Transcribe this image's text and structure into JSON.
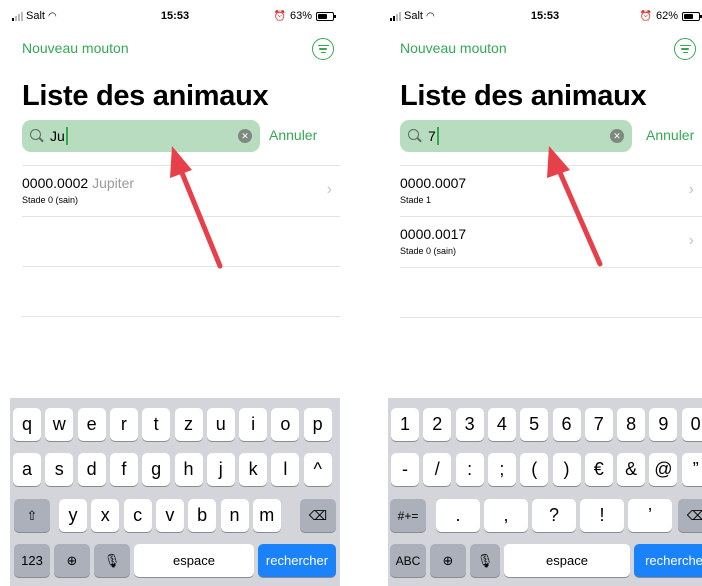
{
  "screens": [
    {
      "status": {
        "carrier": "Salt",
        "time": "15:53",
        "battery": "63%",
        "battery_level": 0.63
      },
      "nav": {
        "new_label": "Nouveau mouton"
      },
      "title": "Liste des animaux",
      "search": {
        "value": "Ju",
        "cancel": "Annuler"
      },
      "rows": [
        {
          "id": "0000.0002",
          "name": "Jupiter",
          "stage": "Stade 0 (sain)"
        }
      ],
      "keyboard": {
        "row1": [
          "q",
          "w",
          "e",
          "r",
          "t",
          "z",
          "u",
          "i",
          "o",
          "p"
        ],
        "row2": [
          "a",
          "s",
          "d",
          "f",
          "g",
          "h",
          "j",
          "k",
          "l",
          "^"
        ],
        "row3": [
          "y",
          "x",
          "c",
          "v",
          "b",
          "n",
          "m"
        ],
        "mode_key": "123",
        "space": "espace",
        "go": "rechercher"
      }
    },
    {
      "status": {
        "carrier": "Salt",
        "time": "15:53",
        "battery": "62%",
        "battery_level": 0.62
      },
      "nav": {
        "new_label": "Nouveau mouton"
      },
      "title": "Liste des animaux",
      "search": {
        "value": "7",
        "cancel": "Annuler"
      },
      "rows": [
        {
          "id": "0000.0007",
          "name": "",
          "stage": "Stade 1"
        },
        {
          "id": "0000.0017",
          "name": "",
          "stage": "Stade 0 (sain)"
        }
      ],
      "keyboard": {
        "row1": [
          "1",
          "2",
          "3",
          "4",
          "5",
          "6",
          "7",
          "8",
          "9",
          "0"
        ],
        "row2": [
          "-",
          "/",
          ":",
          ";",
          "(",
          ")",
          "€",
          "&",
          "@",
          "”"
        ],
        "row3": [
          ".",
          ",",
          "?",
          "!",
          "’"
        ],
        "shift_label": "#+=",
        "mode_key": "ABC",
        "space": "espace",
        "go": "recherche"
      }
    }
  ],
  "icons": {
    "search": "magnifier-icon",
    "clear": "clear-circle-icon",
    "filter": "filter-circle-icon",
    "globe": "globe-icon",
    "mic": "microphone-icon",
    "backspace": "backspace-icon",
    "shift": "shift-icon",
    "chevron": "chevron-right-icon",
    "arrow": "red-annotation-arrow"
  },
  "colors": {
    "accent": "#34a853",
    "search_bg": "#b7dcc0",
    "go_key": "#1a82fb",
    "arrow": "#e8404a"
  }
}
